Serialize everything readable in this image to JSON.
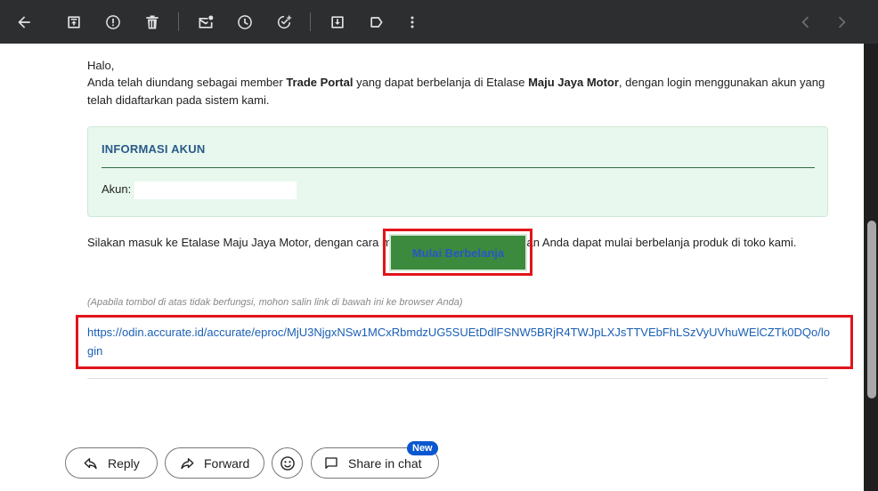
{
  "toolbar": {
    "icons": [
      "back-icon",
      "archive-icon",
      "report-spam-icon",
      "delete-icon",
      "mark-unread-icon",
      "snooze-icon",
      "add-to-tasks-icon",
      "move-to-icon",
      "label-icon",
      "more-icon",
      "prev-icon",
      "next-icon"
    ]
  },
  "email": {
    "greeting": "Halo,",
    "intro_before_1": "Anda telah diundang sebagai member ",
    "intro_bold_1": "Trade Portal",
    "intro_mid": " yang dapat berbelanja di Etalase ",
    "intro_bold_2": "Maju Jaya Motor",
    "intro_after": ", dengan login menggunakan akun yang telah didaftarkan pada sistem kami.",
    "info_box": {
      "title": "INFORMASI AKUN",
      "account_label": "Akun:"
    },
    "instruction": "Silakan masuk ke Etalase Maju Jaya Motor, dengan cara menekan tombol di bawah dan Anda dapat mulai berbelanja produk di toko kami.",
    "cta_label": "Mulai Berbelanja",
    "fallback_note": "(Apabila tombol di atas tidak berfungsi, mohon salin link di bawah ini ke browser Anda)",
    "fallback_link": "https://odin.accurate.id/accurate/eproc/MjU3NjgxNSw1MCxRbmdzUG5SUEtDdlFSNW5BRjR4TWJpLXJsTTVEbFhLSzVyUVhuWElCZTk0DQo/login"
  },
  "actions": {
    "reply_label": "Reply",
    "forward_label": "Forward",
    "share_label": "Share in chat",
    "new_badge": "New"
  },
  "colors": {
    "toolbar_bg": "#2d2e30",
    "info_box_bg": "#e8f8ee",
    "cta_bg": "#3b8a3e",
    "highlight_red": "#e1141b",
    "link_blue": "#1a5fb4"
  }
}
